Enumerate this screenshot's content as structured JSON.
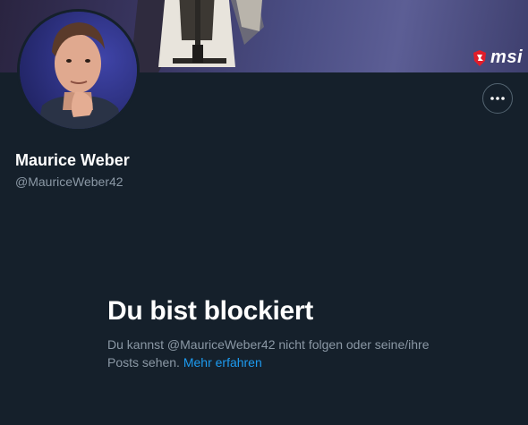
{
  "profile": {
    "display_name": "Maurice Weber",
    "handle": "@MauriceWeber42"
  },
  "banner": {
    "logo_text": "msi"
  },
  "blocked": {
    "title": "Du bist blockiert",
    "message": "Du kannst @MauriceWeber42 nicht folgen oder seine/ihre Posts sehen.",
    "learn_more": "Mehr erfahren"
  },
  "icons": {
    "more": "more-horizontal-icon",
    "brand": "msi-dragon-icon"
  },
  "colors": {
    "background": "#15202b",
    "text_primary": "#ffffff",
    "text_secondary": "#8b98a5",
    "link": "#1d9bf0",
    "brand_red": "#e11d2a"
  }
}
